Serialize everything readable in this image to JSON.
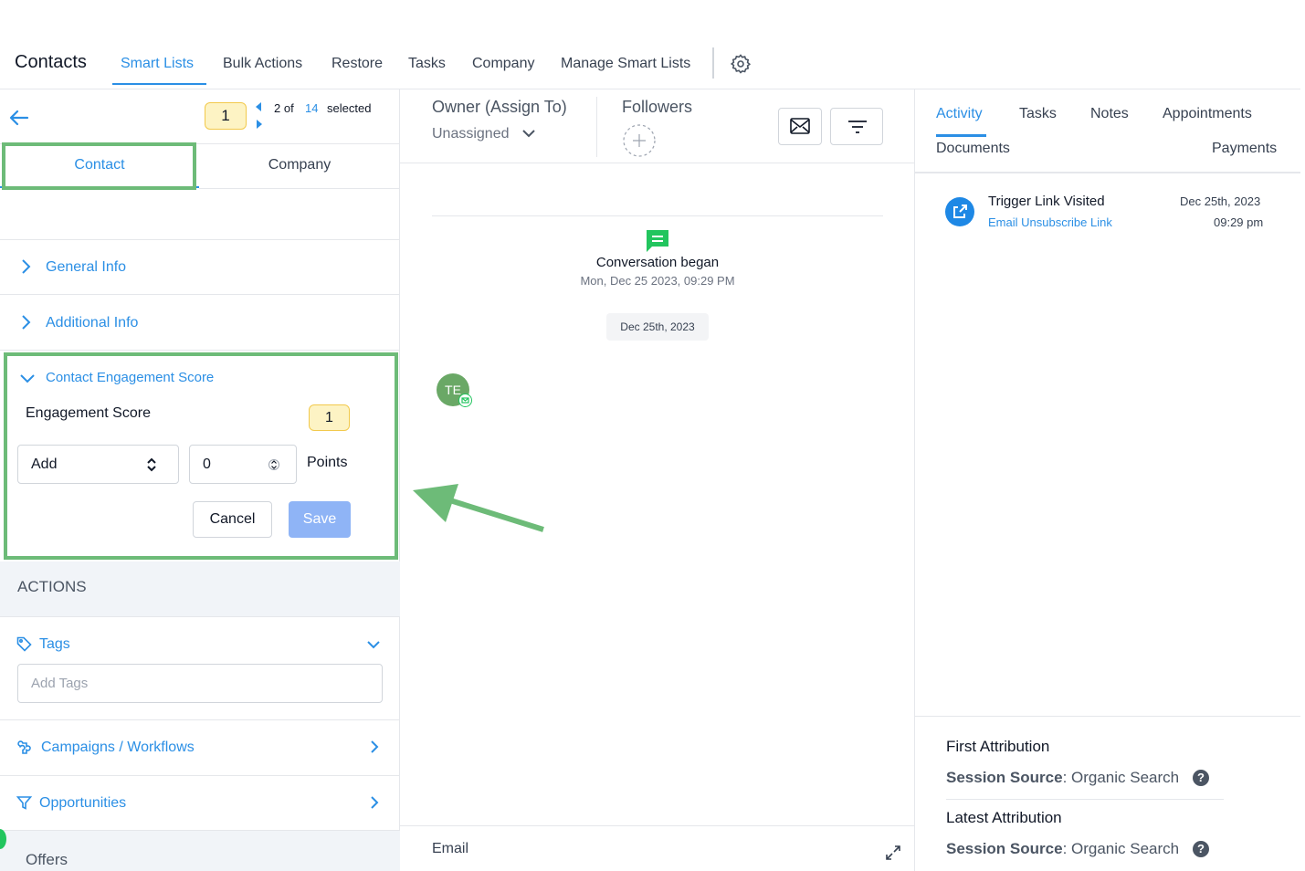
{
  "topnav": {
    "title": "Contacts",
    "tabs": [
      "Smart Lists",
      "Bulk Actions",
      "Restore",
      "Tasks",
      "Company",
      "Manage Smart Lists"
    ]
  },
  "left": {
    "pager": {
      "badge": "1",
      "position": "2 of",
      "total": "14",
      "selected_label": "selected"
    },
    "tabs": {
      "contact": "Contact",
      "company": "Company"
    },
    "sections": {
      "general": "General Info",
      "additional": "Additional Info",
      "engagement": "Contact Engagement Score"
    },
    "engagement": {
      "label": "Engagement Score",
      "score": "1",
      "operation_value": "Add",
      "points_value": "0",
      "points_label": "Points",
      "cancel": "Cancel",
      "save": "Save"
    },
    "actions_header": "ACTIONS",
    "tags": {
      "label": "Tags",
      "placeholder": "Add Tags"
    },
    "campaigns_label": "Campaigns / Workflows",
    "opportunities_label": "Opportunities",
    "offers_label": "Offers"
  },
  "center": {
    "owner_label": "Owner (Assign To)",
    "owner_value": "Unassigned",
    "followers_label": "Followers",
    "conversation": {
      "title": "Conversation began",
      "date": "Mon, Dec 25 2023, 09:29 PM"
    },
    "date_chip": "Dec 25th, 2023",
    "avatar_initials": "TE",
    "composer_label": "Email"
  },
  "right": {
    "tabs": [
      "Activity",
      "Tasks",
      "Notes",
      "Appointments",
      "Documents",
      "Payments"
    ],
    "activity": {
      "title": "Trigger Link Visited",
      "link": "Email Unsubscribe Link",
      "date": "Dec 25th, 2023",
      "time": "09:29 pm"
    },
    "first_attribution": {
      "title": "First Attribution",
      "key": "Session Source",
      "value": ": Organic Search"
    },
    "latest_attribution": {
      "title": "Latest Attribution",
      "key": "Session Source",
      "value": ": Organic Search"
    }
  },
  "colors": {
    "accent": "#2b8fe5",
    "highlight_green": "#6dbb78",
    "badge_yellow": "#fdf3c4",
    "save_disabled": "#8fb4f6"
  }
}
